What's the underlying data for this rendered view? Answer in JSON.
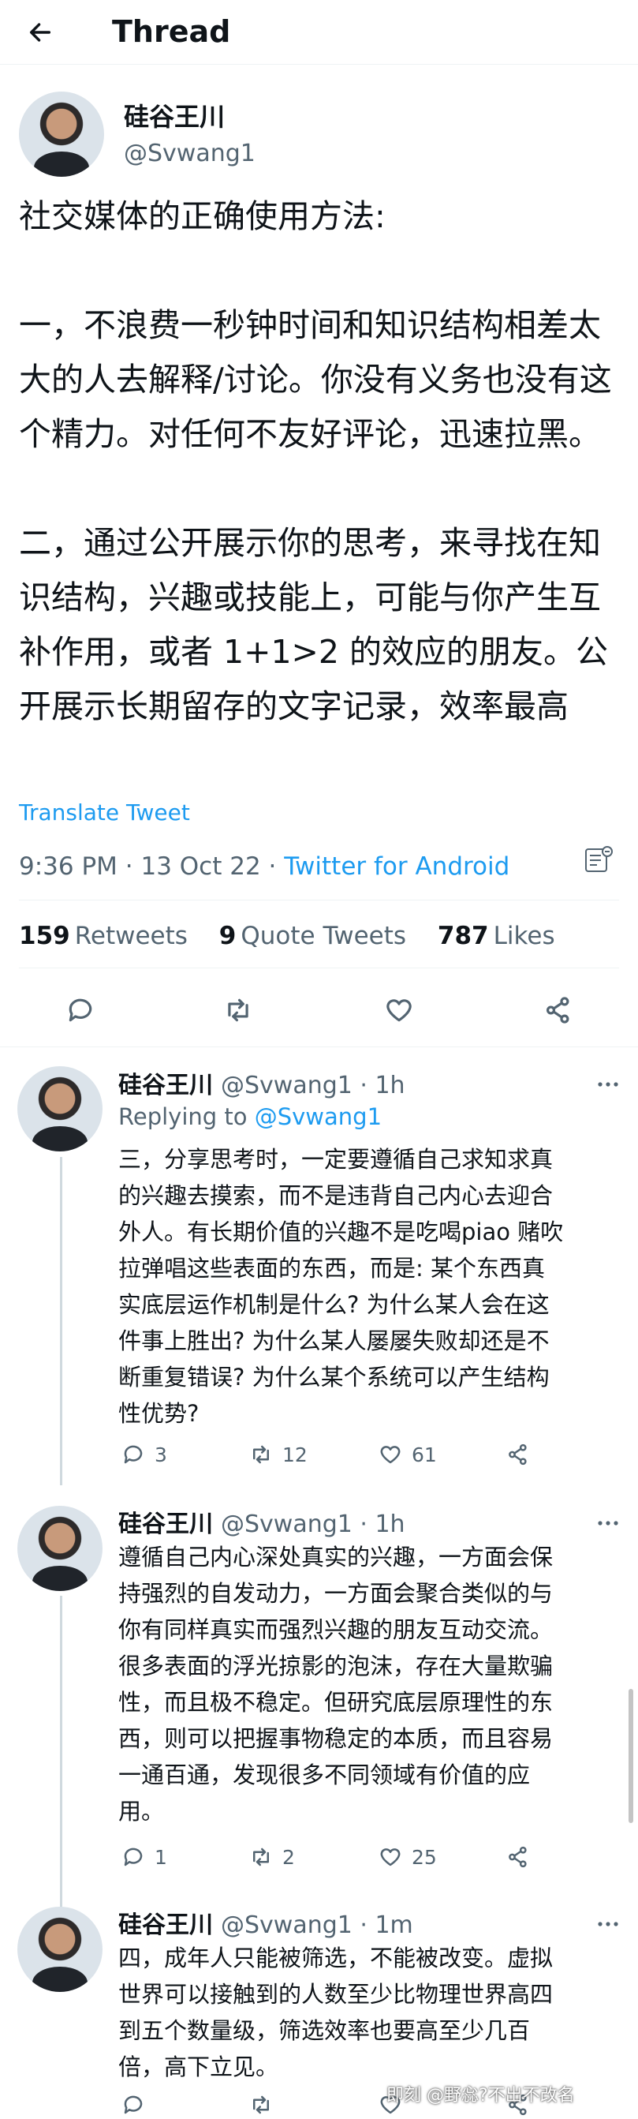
{
  "header": {
    "title": "Thread"
  },
  "main_tweet": {
    "name": "硅谷王川",
    "handle": "@Svwang1",
    "text": "社交媒体的正确使用方法:\n\n一，不浪费一秒钟时间和知识结构相差太大的人去解释/讨论。你没有义务也没有这个精力。对任何不友好评论，迅速拉黑。\n\n二，通过公开展示你的思考，来寻找在知识结构，兴趣或技能上，可能与你产生互补作用，或者 1+1>2 的效应的朋友。公开展示长期留存的文字记录，效率最高",
    "translate": "Translate Tweet",
    "time": "9:36 PM · 13 Oct 22 · ",
    "client": "Twitter for Android",
    "stats": {
      "retweets_count": "159",
      "retweets_label": "Retweets",
      "quotes_count": "9",
      "quotes_label": "Quote Tweets",
      "likes_count": "787",
      "likes_label": "Likes"
    }
  },
  "replies": [
    {
      "name": "硅谷王川",
      "meta": "@Svwang1 · 1h",
      "replying_prefix": "Replying to ",
      "replying_to": "@Svwang1",
      "text": "三，分享思考时，一定要遵循自己求知求真\n的兴趣去摸索，而不是违背自己内心去迎合\n外人。有长期价值的兴趣不是吃喝piao 赌吹\n拉弹唱这些表面的东西，而是: 某个东西真\n实底层运作机制是什么? 为什么某人会在这\n件事上胜出? 为什么某人屡屡失败却还是不\n断重复错误? 为什么某个系统可以产生结构\n性优势?",
      "replies": "3",
      "retweets": "12",
      "likes": "61"
    },
    {
      "name": "硅谷王川",
      "meta": "@Svwang1 · 1h",
      "text": "遵循自己内心深处真实的兴趣，一方面会保\n持强烈的自发动力，一方面会聚合类似的与\n你有同样真实而强烈兴趣的朋友互动交流。\n很多表面的浮光掠影的泡沫，存在大量欺骗\n性，而且极不稳定。但研究底层原理性的东\n西，则可以把握事物稳定的本质，而且容易\n一通百通，发现很多不同领域有价值的应\n用。",
      "replies": "1",
      "retweets": "2",
      "likes": "25"
    },
    {
      "name": "硅谷王川",
      "meta": "@Svwang1 · 1m",
      "text": "四，成年人只能被筛选，不能被改变。虚拟\n世界可以接触到的人数至少比物理世界高四\n到五个数量级，筛选效率也要高至少几百\n倍，高下立见。"
    }
  ],
  "watermark": "即刻 @野惢?不出不改名",
  "icons": [
    "back-arrow-icon",
    "analytics-icon",
    "reply-icon",
    "retweet-icon",
    "like-icon",
    "share-icon",
    "more-icon"
  ]
}
